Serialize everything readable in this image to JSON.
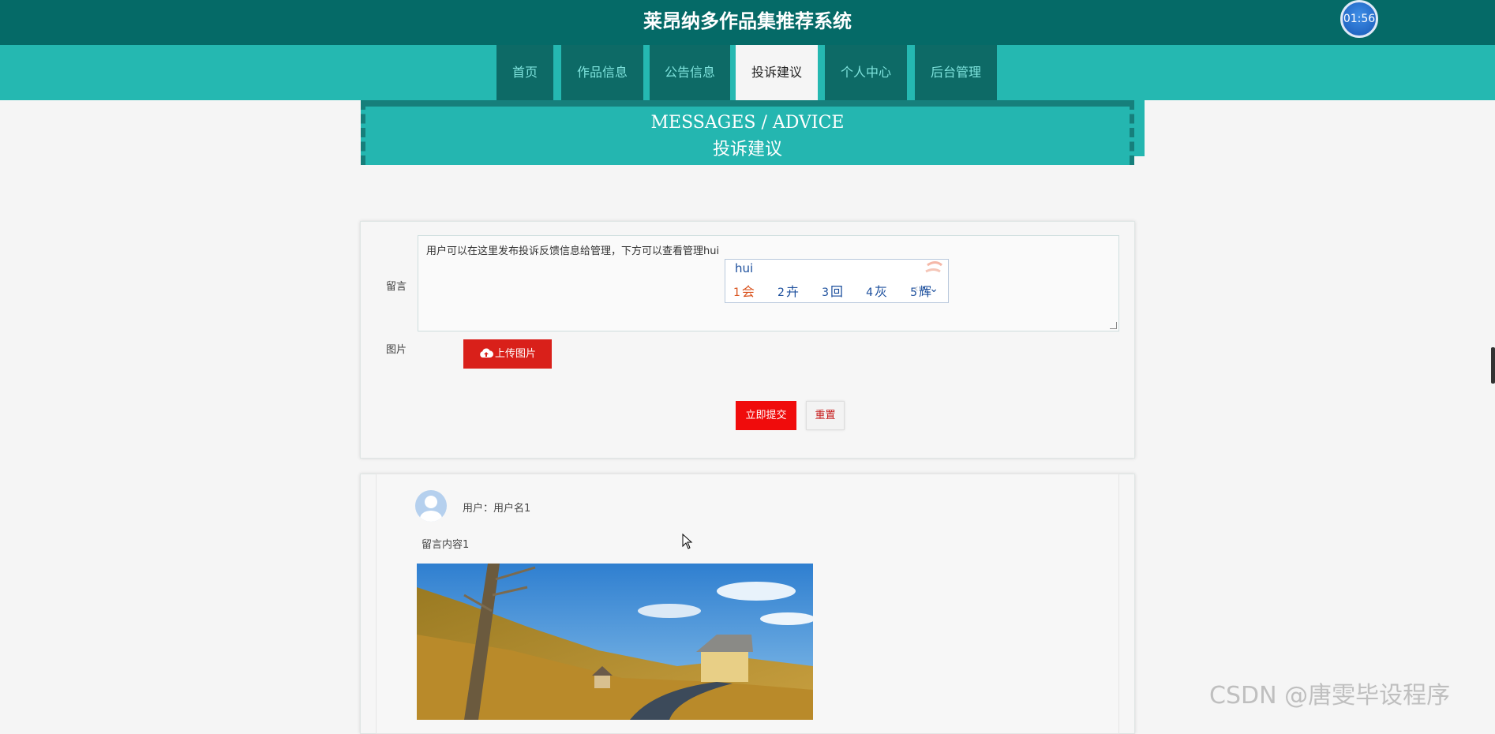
{
  "app": {
    "title": "莱昂纳多作品集推荐系统"
  },
  "timer": "01:56",
  "nav": [
    {
      "label": "首页"
    },
    {
      "label": "作品信息"
    },
    {
      "label": "公告信息"
    },
    {
      "label": "投诉建议",
      "active": true
    },
    {
      "label": "个人中心"
    },
    {
      "label": "后台管理"
    }
  ],
  "banner": {
    "en": "MESSAGES / ADVICE",
    "cn": "投诉建议"
  },
  "form": {
    "message_label": "留言",
    "message_value": "用户可以在这里发布投诉反馈信息给管理，下方可以查看管理hui",
    "image_label": "图片",
    "upload_label": "上传图片",
    "submit_label": "立即提交",
    "reset_label": "重置"
  },
  "ime": {
    "input": "hui",
    "candidates": [
      {
        "num": "1",
        "text": "会"
      },
      {
        "num": "2",
        "text": "卉"
      },
      {
        "num": "3",
        "text": "回"
      },
      {
        "num": "4",
        "text": "灰"
      },
      {
        "num": "5",
        "text": "辉"
      }
    ]
  },
  "messages": [
    {
      "user": "用户：用户名1",
      "content": "留言内容1"
    }
  ],
  "watermark": "CSDN @唐雯毕设程序",
  "colors": {
    "header": "#056a67",
    "nav": "#25b8b1",
    "accent": "#f00c0c"
  }
}
